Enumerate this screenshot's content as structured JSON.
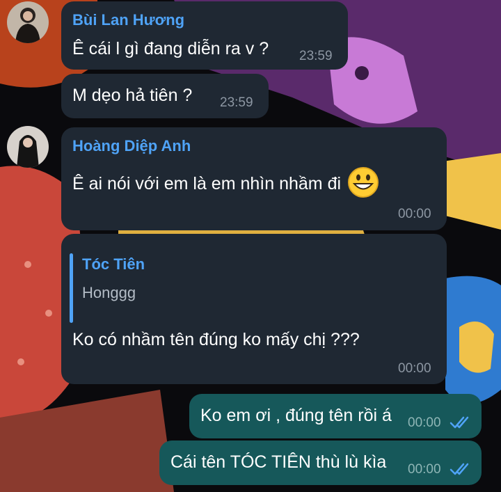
{
  "messages": [
    {
      "sender": "Bùi Lan Hương",
      "text": "Ê cái l gì đang diễn ra v ?",
      "time": "23:59"
    },
    {
      "text": "M dẹo hả tiên ?",
      "time": "23:59"
    },
    {
      "sender": "Hoàng Diệp Anh",
      "text": "Ê ai nói với em là em nhìn nhầm đi",
      "emoji": "grinning-face-emoji",
      "time": "00:00"
    },
    {
      "reply": {
        "name": "Tóc Tiên",
        "text": "Honggg"
      },
      "text": "Ko có nhầm tên đúng ko mấy chị ???",
      "time": "00:00"
    },
    {
      "outgoing": true,
      "text": "Ko em ơi , đúng tên rồi á",
      "time": "00:00",
      "status": "read-double-check-icon"
    },
    {
      "outgoing": true,
      "text": "Cái tên TÓC TIÊN thù lù kìa",
      "time": "00:00",
      "status": "read-double-check-icon"
    }
  ],
  "colors": {
    "incoming_bubble": "#1f2833",
    "outgoing_bubble": "#16585a",
    "sender_name": "#4fa3f7",
    "read_ticks": "#4fa3f7"
  }
}
